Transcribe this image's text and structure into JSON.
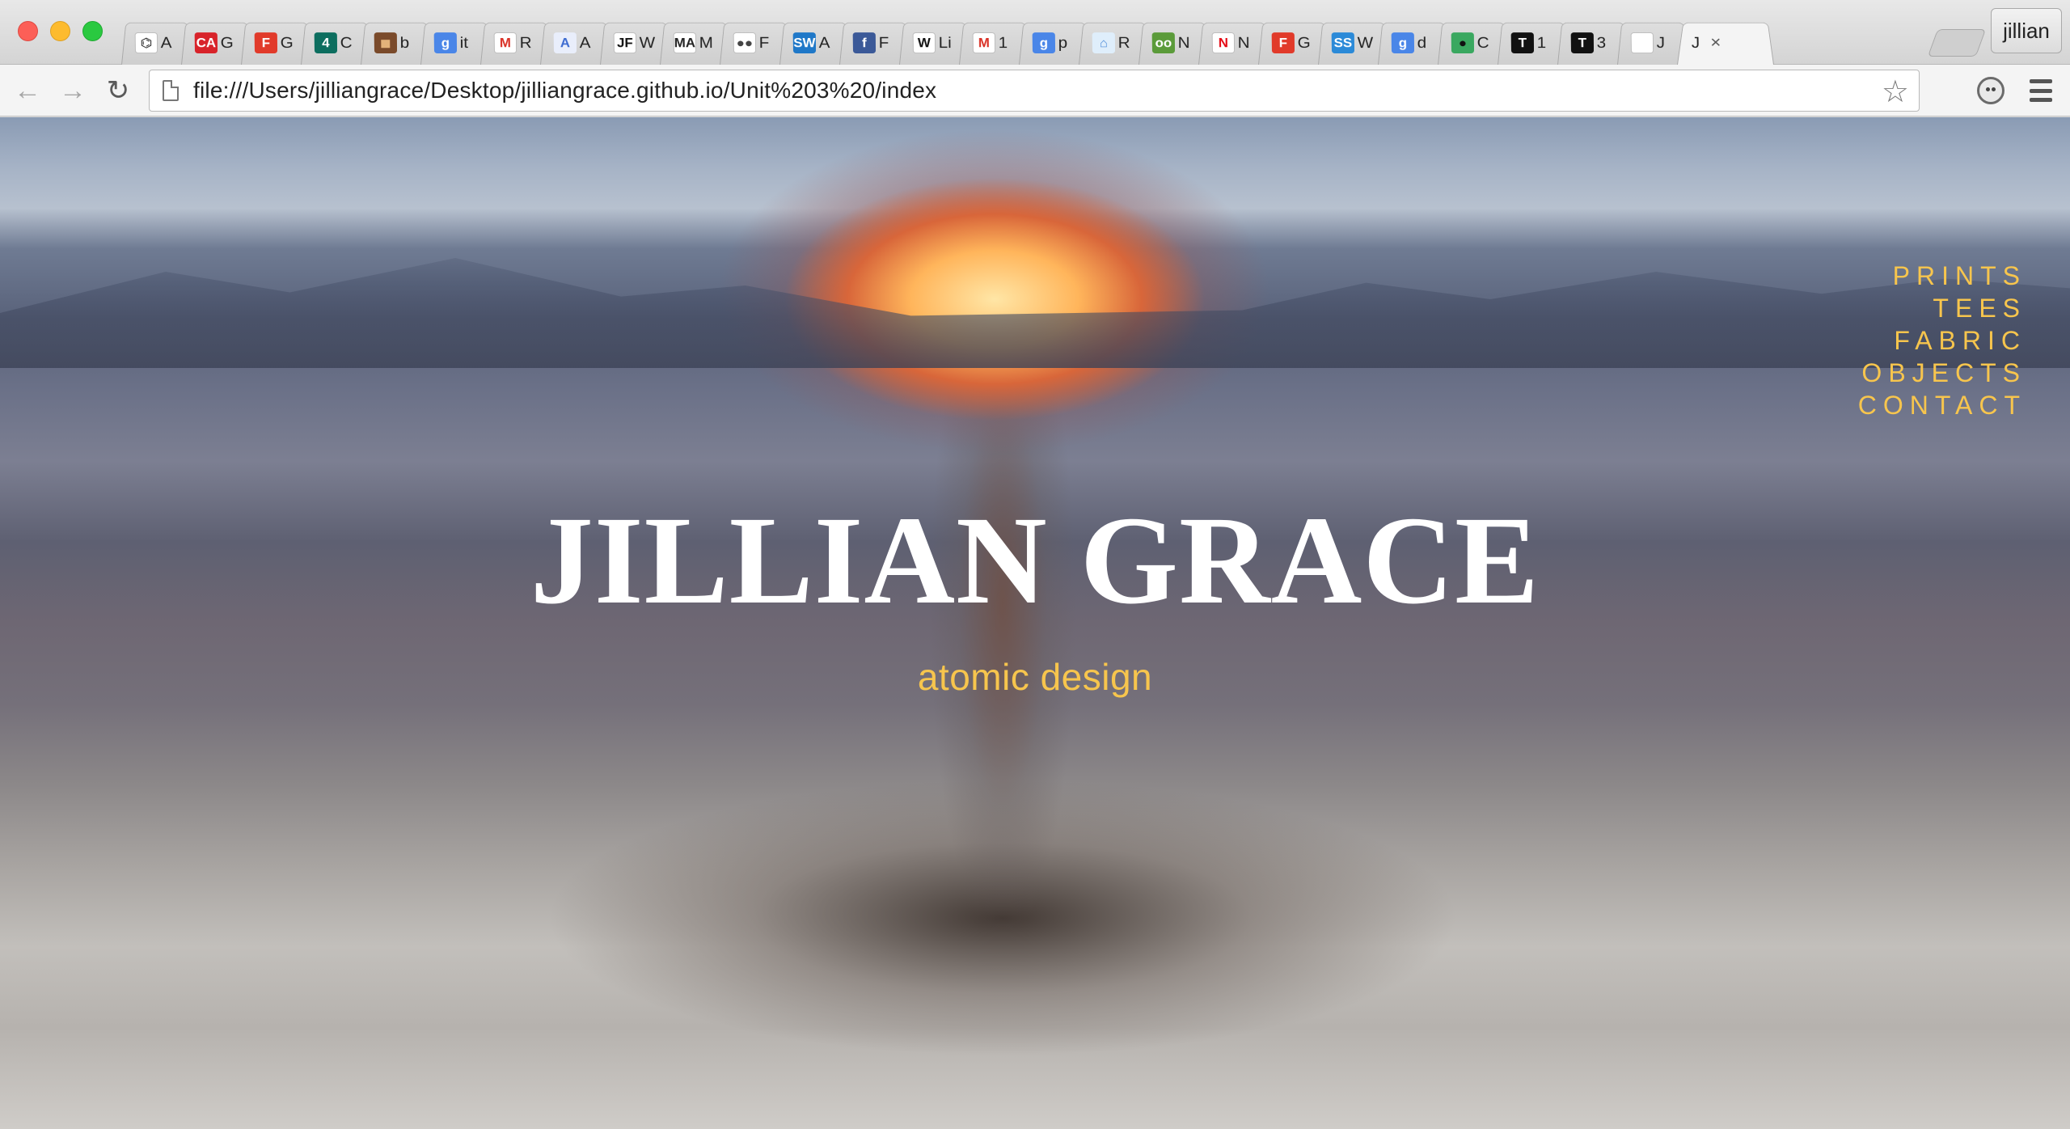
{
  "browser": {
    "tabs": [
      {
        "icon": "codepen-icon",
        "letter": "⌬",
        "bg": "#ffffff",
        "fg": "#111111",
        "title": "A"
      },
      {
        "icon": "creative-assembly-icon",
        "letter": "CA",
        "bg": "#d8232a",
        "fg": "#ffffff",
        "title": "G"
      },
      {
        "icon": "fontstruct-icon",
        "letter": "F",
        "bg": "#e13a2a",
        "fg": "#ffffff",
        "title": "G"
      },
      {
        "icon": "channel-4-icon",
        "letter": "4",
        "bg": "#0d6e5f",
        "fg": "#ffffff",
        "title": "C"
      },
      {
        "icon": "photo-icon",
        "letter": "◼",
        "bg": "#7a4a2a",
        "fg": "#e3b27a",
        "title": "b"
      },
      {
        "icon": "google-icon",
        "letter": "g",
        "bg": "#4a86e8",
        "fg": "#ffffff",
        "title": "it"
      },
      {
        "icon": "gmail-icon",
        "letter": "M",
        "bg": "#ffffff",
        "fg": "#d93025",
        "title": "R"
      },
      {
        "icon": "font-a-icon",
        "letter": "A",
        "bg": "#e9eefb",
        "fg": "#3b6ad0",
        "title": "A"
      },
      {
        "icon": "jf-icon",
        "letter": "JF",
        "bg": "#ffffff",
        "fg": "#111111",
        "title": "W"
      },
      {
        "icon": "mam-icon",
        "letter": "MA",
        "bg": "#ffffff",
        "fg": "#222222",
        "title": "M"
      },
      {
        "icon": "flickr-icon",
        "letter": "●●",
        "bg": "#ffffff",
        "fg": "#444444",
        "title": "F"
      },
      {
        "icon": "sw-icon",
        "letter": "SW",
        "bg": "#1f78c8",
        "fg": "#ffffff",
        "title": "A"
      },
      {
        "icon": "facebook-icon",
        "letter": "f",
        "bg": "#3b5998",
        "fg": "#ffffff",
        "title": "F"
      },
      {
        "icon": "wikipedia-icon",
        "letter": "W",
        "bg": "#ffffff",
        "fg": "#111111",
        "title": "Li"
      },
      {
        "icon": "gmail-icon",
        "letter": "M",
        "bg": "#ffffff",
        "fg": "#d93025",
        "title": "1"
      },
      {
        "icon": "google-icon",
        "letter": "g",
        "bg": "#4a86e8",
        "fg": "#ffffff",
        "title": "p"
      },
      {
        "icon": "home-icon",
        "letter": "⌂",
        "bg": "#dfeefb",
        "fg": "#4a8ad8",
        "title": "R"
      },
      {
        "icon": "owl-icon",
        "letter": "oo",
        "bg": "#5b9b3a",
        "fg": "#ffffff",
        "title": "N"
      },
      {
        "icon": "netflix-icon",
        "letter": "N",
        "bg": "#ffffff",
        "fg": "#e50914",
        "title": "N"
      },
      {
        "icon": "fontstruct-icon",
        "letter": "F",
        "bg": "#e13a2a",
        "fg": "#ffffff",
        "title": "G"
      },
      {
        "icon": "ss-icon",
        "letter": "SS",
        "bg": "#2b8ad8",
        "fg": "#ffffff",
        "title": "W"
      },
      {
        "icon": "google-icon",
        "letter": "g",
        "bg": "#4a86e8",
        "fg": "#ffffff",
        "title": "d"
      },
      {
        "icon": "silhouette-icon",
        "letter": "●",
        "bg": "#3aa860",
        "fg": "#111111",
        "title": "C"
      },
      {
        "icon": "t-icon",
        "letter": "T",
        "bg": "#111111",
        "fg": "#ffffff",
        "title": "1"
      },
      {
        "icon": "t-icon",
        "letter": "T",
        "bg": "#111111",
        "fg": "#ffffff",
        "title": "3"
      },
      {
        "icon": "blank-page-icon",
        "letter": "",
        "bg": "#ffffff",
        "fg": "#999999",
        "title": "J"
      }
    ],
    "active_tab": {
      "title": "J",
      "close": "×"
    },
    "profile_name": "jillian",
    "url": "file:///Users/jilliangrace/Desktop/jilliangrace.github.io/Unit%203%20/index",
    "back_glyph": "←",
    "forward_glyph": "→",
    "reload_glyph": "↻",
    "star_glyph": "☆"
  },
  "page": {
    "title": "JILLIAN GRACE",
    "tagline": "atomic design",
    "accent_color": "#f7c54d",
    "nav": [
      {
        "id": "prints",
        "label": "PRINTS"
      },
      {
        "id": "tees",
        "label": "TEES"
      },
      {
        "id": "fabric",
        "label": "FABRIC"
      },
      {
        "id": "objects",
        "label": "OBJECTS"
      },
      {
        "id": "contact",
        "label": "CONTACT"
      }
    ]
  }
}
